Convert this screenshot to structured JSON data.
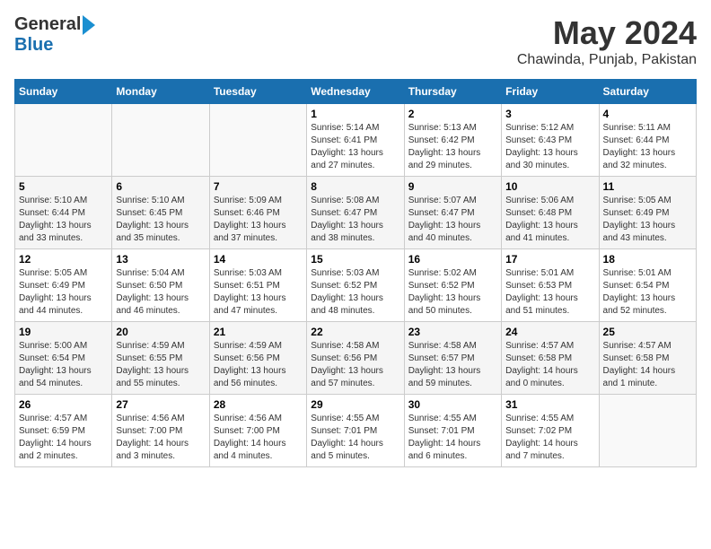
{
  "header": {
    "logo_general": "General",
    "logo_blue": "Blue",
    "main_title": "May 2024",
    "subtitle": "Chawinda, Punjab, Pakistan"
  },
  "calendar": {
    "days_of_week": [
      "Sunday",
      "Monday",
      "Tuesday",
      "Wednesday",
      "Thursday",
      "Friday",
      "Saturday"
    ],
    "weeks": [
      [
        {
          "date": "",
          "info": ""
        },
        {
          "date": "",
          "info": ""
        },
        {
          "date": "",
          "info": ""
        },
        {
          "date": "1",
          "info": "Sunrise: 5:14 AM\nSunset: 6:41 PM\nDaylight: 13 hours\nand 27 minutes."
        },
        {
          "date": "2",
          "info": "Sunrise: 5:13 AM\nSunset: 6:42 PM\nDaylight: 13 hours\nand 29 minutes."
        },
        {
          "date": "3",
          "info": "Sunrise: 5:12 AM\nSunset: 6:43 PM\nDaylight: 13 hours\nand 30 minutes."
        },
        {
          "date": "4",
          "info": "Sunrise: 5:11 AM\nSunset: 6:44 PM\nDaylight: 13 hours\nand 32 minutes."
        }
      ],
      [
        {
          "date": "5",
          "info": "Sunrise: 5:10 AM\nSunset: 6:44 PM\nDaylight: 13 hours\nand 33 minutes."
        },
        {
          "date": "6",
          "info": "Sunrise: 5:10 AM\nSunset: 6:45 PM\nDaylight: 13 hours\nand 35 minutes."
        },
        {
          "date": "7",
          "info": "Sunrise: 5:09 AM\nSunset: 6:46 PM\nDaylight: 13 hours\nand 37 minutes."
        },
        {
          "date": "8",
          "info": "Sunrise: 5:08 AM\nSunset: 6:47 PM\nDaylight: 13 hours\nand 38 minutes."
        },
        {
          "date": "9",
          "info": "Sunrise: 5:07 AM\nSunset: 6:47 PM\nDaylight: 13 hours\nand 40 minutes."
        },
        {
          "date": "10",
          "info": "Sunrise: 5:06 AM\nSunset: 6:48 PM\nDaylight: 13 hours\nand 41 minutes."
        },
        {
          "date": "11",
          "info": "Sunrise: 5:05 AM\nSunset: 6:49 PM\nDaylight: 13 hours\nand 43 minutes."
        }
      ],
      [
        {
          "date": "12",
          "info": "Sunrise: 5:05 AM\nSunset: 6:49 PM\nDaylight: 13 hours\nand 44 minutes."
        },
        {
          "date": "13",
          "info": "Sunrise: 5:04 AM\nSunset: 6:50 PM\nDaylight: 13 hours\nand 46 minutes."
        },
        {
          "date": "14",
          "info": "Sunrise: 5:03 AM\nSunset: 6:51 PM\nDaylight: 13 hours\nand 47 minutes."
        },
        {
          "date": "15",
          "info": "Sunrise: 5:03 AM\nSunset: 6:52 PM\nDaylight: 13 hours\nand 48 minutes."
        },
        {
          "date": "16",
          "info": "Sunrise: 5:02 AM\nSunset: 6:52 PM\nDaylight: 13 hours\nand 50 minutes."
        },
        {
          "date": "17",
          "info": "Sunrise: 5:01 AM\nSunset: 6:53 PM\nDaylight: 13 hours\nand 51 minutes."
        },
        {
          "date": "18",
          "info": "Sunrise: 5:01 AM\nSunset: 6:54 PM\nDaylight: 13 hours\nand 52 minutes."
        }
      ],
      [
        {
          "date": "19",
          "info": "Sunrise: 5:00 AM\nSunset: 6:54 PM\nDaylight: 13 hours\nand 54 minutes."
        },
        {
          "date": "20",
          "info": "Sunrise: 4:59 AM\nSunset: 6:55 PM\nDaylight: 13 hours\nand 55 minutes."
        },
        {
          "date": "21",
          "info": "Sunrise: 4:59 AM\nSunset: 6:56 PM\nDaylight: 13 hours\nand 56 minutes."
        },
        {
          "date": "22",
          "info": "Sunrise: 4:58 AM\nSunset: 6:56 PM\nDaylight: 13 hours\nand 57 minutes."
        },
        {
          "date": "23",
          "info": "Sunrise: 4:58 AM\nSunset: 6:57 PM\nDaylight: 13 hours\nand 59 minutes."
        },
        {
          "date": "24",
          "info": "Sunrise: 4:57 AM\nSunset: 6:58 PM\nDaylight: 14 hours\nand 0 minutes."
        },
        {
          "date": "25",
          "info": "Sunrise: 4:57 AM\nSunset: 6:58 PM\nDaylight: 14 hours\nand 1 minute."
        }
      ],
      [
        {
          "date": "26",
          "info": "Sunrise: 4:57 AM\nSunset: 6:59 PM\nDaylight: 14 hours\nand 2 minutes."
        },
        {
          "date": "27",
          "info": "Sunrise: 4:56 AM\nSunset: 7:00 PM\nDaylight: 14 hours\nand 3 minutes."
        },
        {
          "date": "28",
          "info": "Sunrise: 4:56 AM\nSunset: 7:00 PM\nDaylight: 14 hours\nand 4 minutes."
        },
        {
          "date": "29",
          "info": "Sunrise: 4:55 AM\nSunset: 7:01 PM\nDaylight: 14 hours\nand 5 minutes."
        },
        {
          "date": "30",
          "info": "Sunrise: 4:55 AM\nSunset: 7:01 PM\nDaylight: 14 hours\nand 6 minutes."
        },
        {
          "date": "31",
          "info": "Sunrise: 4:55 AM\nSunset: 7:02 PM\nDaylight: 14 hours\nand 7 minutes."
        },
        {
          "date": "",
          "info": ""
        }
      ]
    ]
  }
}
